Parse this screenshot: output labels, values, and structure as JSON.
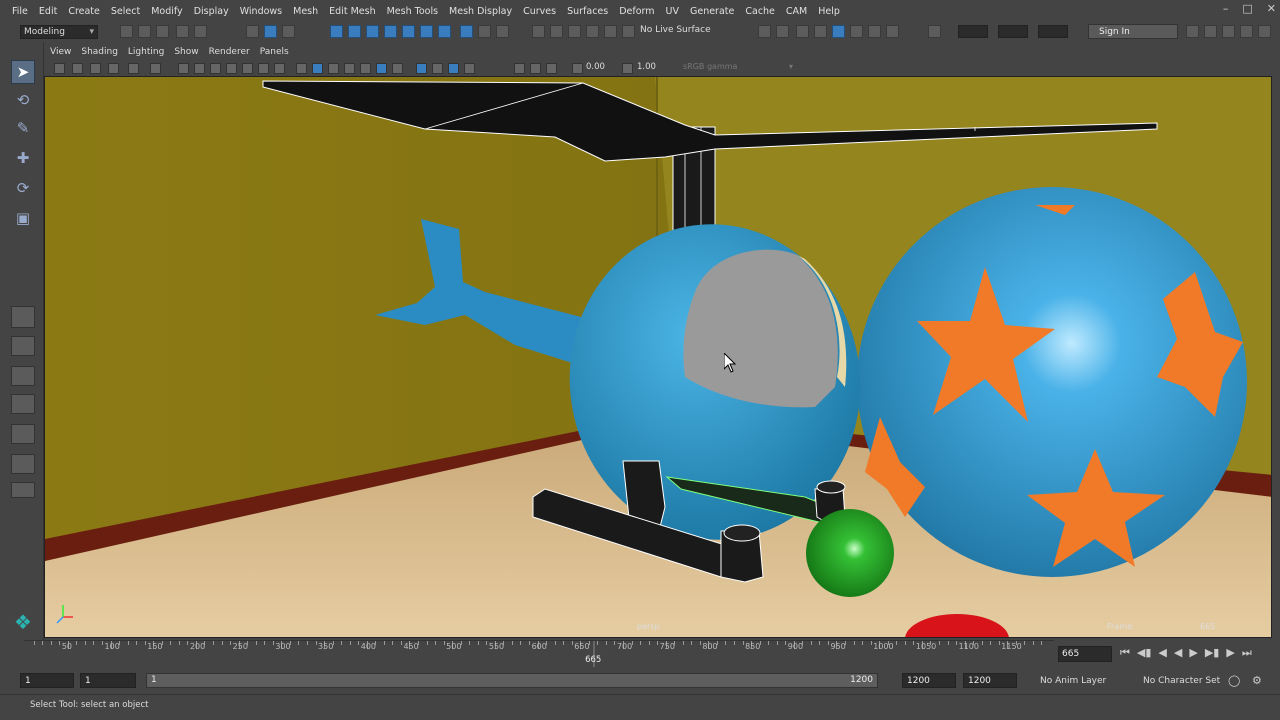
{
  "menubar": {
    "items": [
      "File",
      "Edit",
      "Create",
      "Select",
      "Modify",
      "Display",
      "Windows",
      "Mesh",
      "Edit Mesh",
      "Mesh Tools",
      "Mesh Display",
      "Curves",
      "Surfaces",
      "Deform",
      "UV",
      "Generate",
      "Cache",
      "CAM",
      "Help"
    ]
  },
  "statusline": {
    "mode": "Modeling",
    "live_surface": "No Live Surface",
    "sign_in": "Sign In"
  },
  "panel": {
    "menus": [
      "View",
      "Shading",
      "Lighting",
      "Show",
      "Renderer",
      "Panels"
    ],
    "exposure": "0.00",
    "gamma_value": "1.00",
    "color_space": "sRGB gamma"
  },
  "viewport": {
    "camera": "persp",
    "frame_label": "Frame:",
    "frame_value": "665"
  },
  "timeline": {
    "ticks": [
      "50",
      "100",
      "150",
      "200",
      "250",
      "300",
      "350",
      "400",
      "450",
      "500",
      "550",
      "600",
      "650",
      "700",
      "750",
      "800",
      "850",
      "900",
      "950",
      "1000",
      "1050",
      "1100",
      "1150"
    ],
    "current_frame": "665",
    "current_field": "665"
  },
  "range": {
    "start": "1",
    "playback_start": "1",
    "slider_start": "1",
    "slider_end": "1200",
    "playback_end": "1200",
    "end": "1200",
    "anim_layer": "No Anim Layer",
    "character_set": "No Character Set"
  },
  "helpline": {
    "text": "Select Tool: select an object"
  },
  "colors": {
    "accent": "#3a7dbf",
    "ui_bg": "#444444",
    "wall": "#8a7a18",
    "floor": "#d9b98a",
    "helicopter": "#2c8fc4",
    "ball": "#3b9ad4",
    "stars": "#f07a28",
    "green_ball": "#2fae2f",
    "red_ball": "#d8141a"
  }
}
